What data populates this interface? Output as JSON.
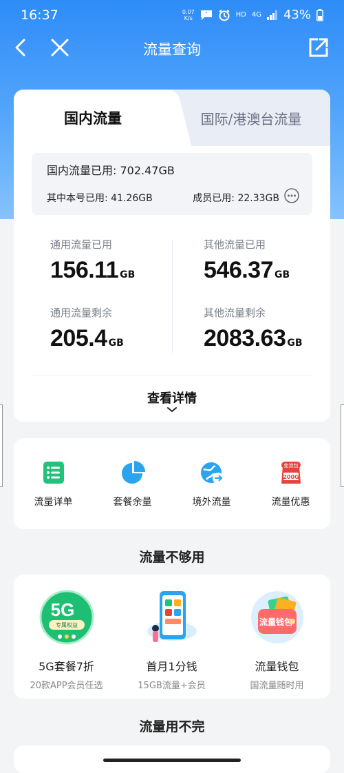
{
  "status_bar": {
    "time": "16:37",
    "net_speed_value": "0.07",
    "net_speed_unit": "K/s",
    "hd": "HD",
    "signal_gen": "4G",
    "battery": "43%"
  },
  "nav": {
    "title": "流量查询"
  },
  "tabs": {
    "domestic": "国内流量",
    "international": "国际/港澳台流量"
  },
  "summary": {
    "total": "国内流量已用: 702.47GB",
    "self_used": "其中本号已用: 41.26GB",
    "member_used": "成员已用: 22.33GB"
  },
  "stats": {
    "general_used": {
      "label": "通用流量已用",
      "value": "156.11",
      "unit": "GB"
    },
    "other_used": {
      "label": "其他流量已用",
      "value": "546.37",
      "unit": "GB"
    },
    "general_left": {
      "label": "通用流量剩余",
      "value": "205.4",
      "unit": "GB"
    },
    "other_left": {
      "label": "其他流量剩余",
      "value": "2083.63",
      "unit": "GB"
    }
  },
  "detail_link": "查看详情",
  "quick_actions": [
    {
      "label": "流量详单",
      "icon": "list-icon"
    },
    {
      "label": "套餐余量",
      "icon": "pie-chart-icon"
    },
    {
      "label": "境外流量",
      "icon": "globe-plane-icon"
    },
    {
      "label": "流量优惠",
      "icon": "coupon-bag-icon"
    }
  ],
  "coupon_icon_text": {
    "top": "免流包",
    "bottom": "200G"
  },
  "section_not_enough": "流量不够用",
  "promos": [
    {
      "title": "5G套餐7折",
      "subtitle": "20款APP会员任选",
      "badge": "5G",
      "badge_sub": "专属权益"
    },
    {
      "title": "首月1分钱",
      "subtitle": "15GB流量+会员"
    },
    {
      "title": "流量钱包",
      "subtitle": "国流量随时用",
      "badge": "流量钱包"
    }
  ],
  "section_unused": "流量用不完",
  "colors": {
    "primary_blue": "#2e8cf8",
    "green": "#22c27a",
    "sky": "#2aa4ee",
    "red": "#e8423c"
  }
}
